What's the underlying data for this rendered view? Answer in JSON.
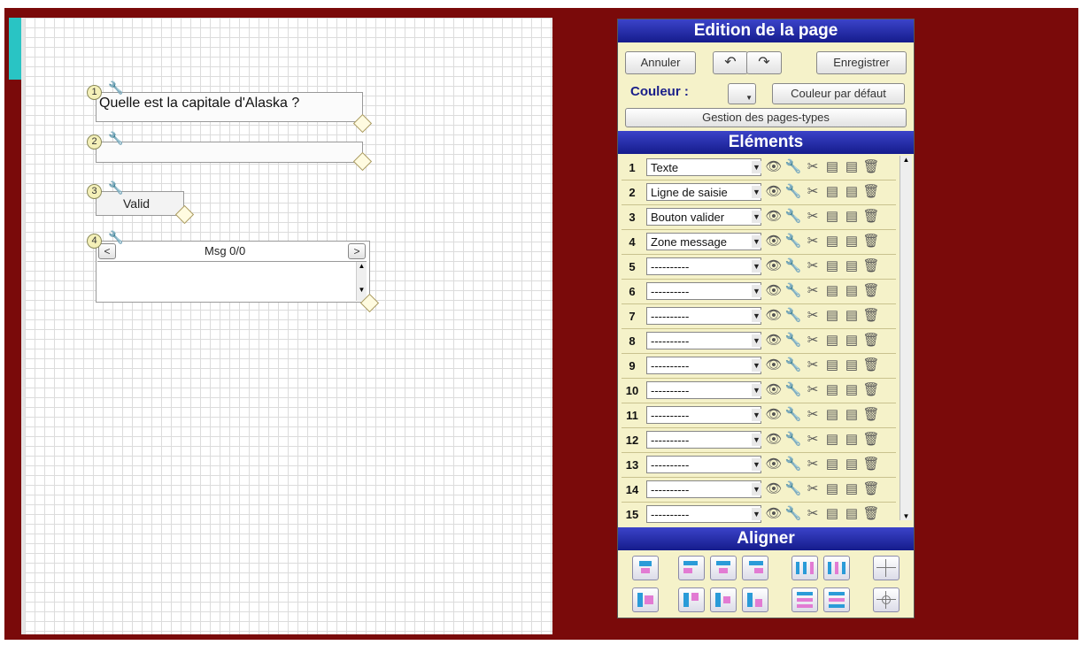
{
  "canvas": {
    "elements": [
      {
        "num": "1",
        "text": "Quelle est la capitale d'Alaska ?"
      },
      {
        "num": "2",
        "text": ""
      },
      {
        "num": "3",
        "text": "Valid"
      },
      {
        "num": "4",
        "prev": "<",
        "next": ">",
        "label": "Msg 0/0"
      }
    ]
  },
  "panel": {
    "edition_title": "Edition de la page",
    "cancel_label": "Annuler",
    "undo_icon": "undo-icon",
    "redo_icon": "redo-icon",
    "save_label": "Enregistrer",
    "color_label": "Couleur :",
    "default_color_label": "Couleur par défaut",
    "page_types_label": "Gestion des pages-types",
    "elements_title": "Eléments",
    "align_title": "Aligner",
    "rows": [
      {
        "num": "1",
        "type": "Texte"
      },
      {
        "num": "2",
        "type": "Ligne de saisie"
      },
      {
        "num": "3",
        "type": "Bouton valider"
      },
      {
        "num": "4",
        "type": "Zone message"
      },
      {
        "num": "5",
        "type": "----------"
      },
      {
        "num": "6",
        "type": "----------"
      },
      {
        "num": "7",
        "type": "----------"
      },
      {
        "num": "8",
        "type": "----------"
      },
      {
        "num": "9",
        "type": "----------"
      },
      {
        "num": "10",
        "type": "----------"
      },
      {
        "num": "11",
        "type": "----------"
      },
      {
        "num": "12",
        "type": "----------"
      },
      {
        "num": "13",
        "type": "----------"
      },
      {
        "num": "14",
        "type": "----------"
      },
      {
        "num": "15",
        "type": "----------"
      }
    ]
  },
  "colors": {
    "background": "#7a0a0a",
    "header": "#1d25a0",
    "panel": "#f5f2c9",
    "accent": "#29c4c4"
  }
}
